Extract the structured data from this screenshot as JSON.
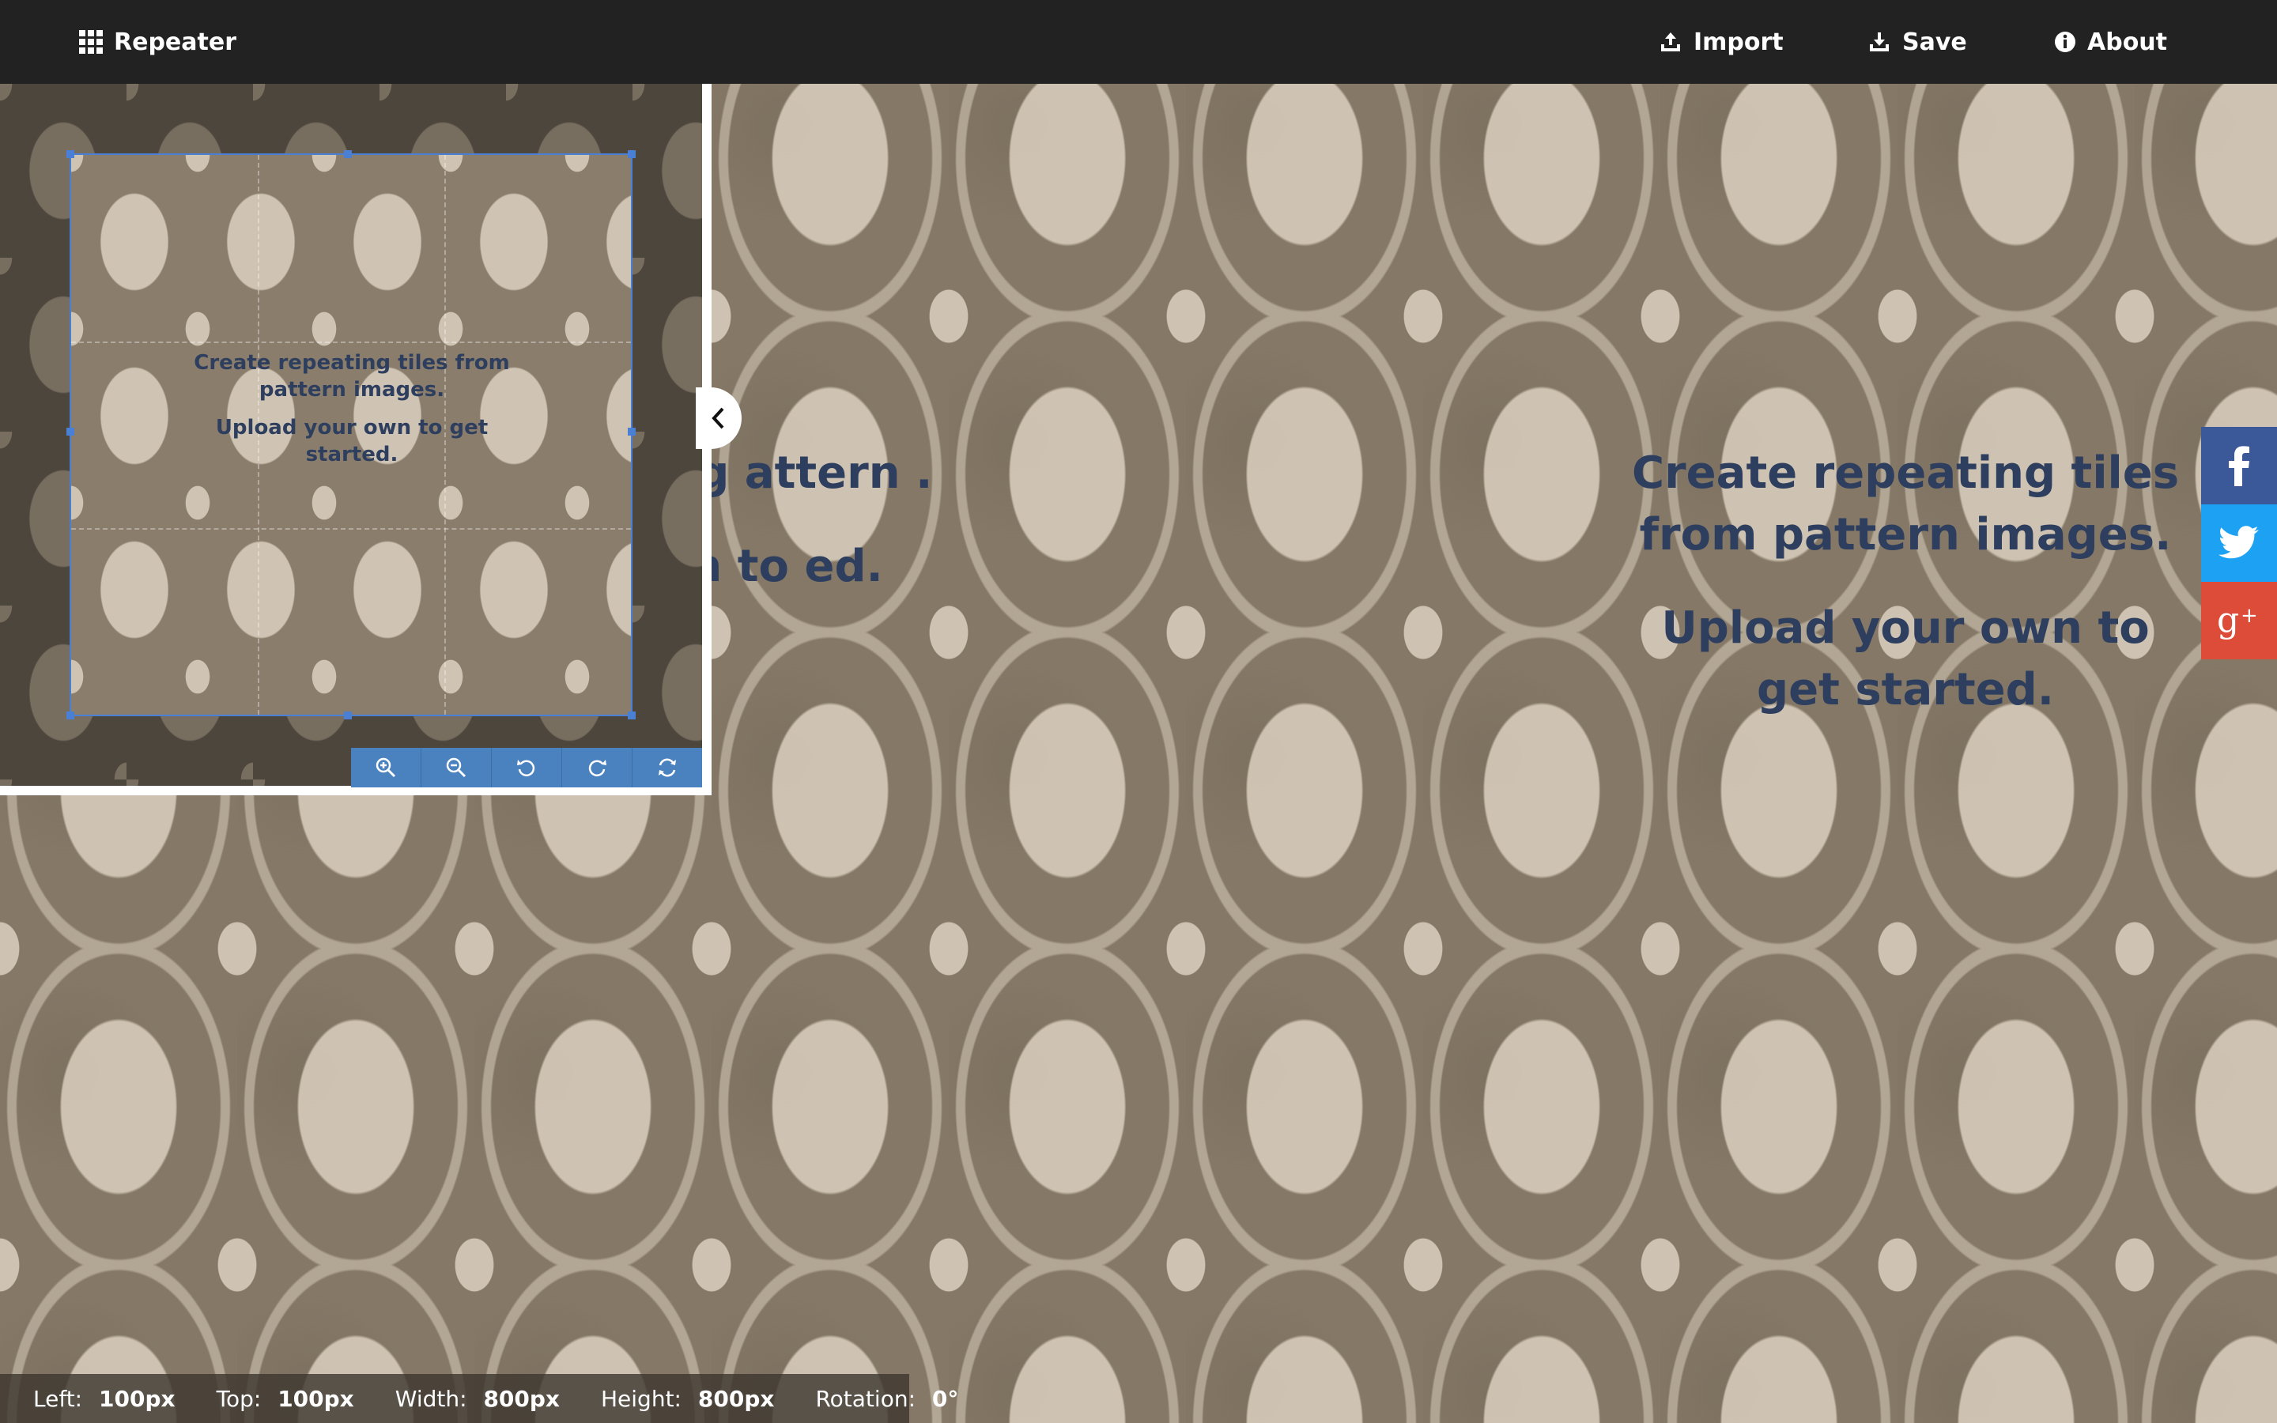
{
  "app": {
    "title": "Repeater"
  },
  "nav": {
    "import_label": "Import",
    "save_label": "Save",
    "about_label": "About"
  },
  "canvas": {
    "headline": "Create repeating tiles from pattern images.",
    "subline": "Upload your own to get started.",
    "partial_headline": "eating attern .",
    "partial_subline": "own to ed."
  },
  "preview": {
    "headline": "Create repeating tiles from pattern images.",
    "subline": "Upload your own to get started."
  },
  "toolbar": {
    "buttons": [
      "zoom-in",
      "zoom-out",
      "rotate-left",
      "rotate-right",
      "reset"
    ]
  },
  "social": {
    "facebook": "f",
    "twitter": "twitter",
    "gplus": "g+"
  },
  "status": {
    "left_label": "Left:",
    "left_value": "100px",
    "top_label": "Top:",
    "top_value": "100px",
    "width_label": "Width:",
    "width_value": "800px",
    "height_label": "Height:",
    "height_value": "800px",
    "rotation_label": "Rotation:",
    "rotation_value": "0°"
  },
  "colors": {
    "topbar": "#222222",
    "accent": "#4a82c0",
    "text_overlay": "#2d3e5e",
    "facebook": "#3b5998",
    "twitter": "#1da1f2",
    "gplus": "#dd4b39"
  }
}
